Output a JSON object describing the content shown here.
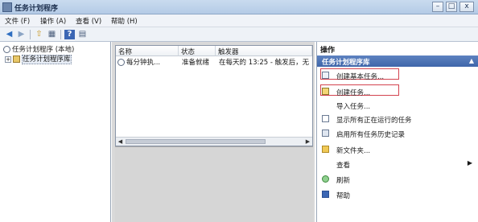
{
  "window": {
    "title": "任务计划程序",
    "minimize_label": "–",
    "maximize_label": "□",
    "close_label": "x"
  },
  "menu": {
    "file": "文件 (F)",
    "action": "操作 (A)",
    "view": "查看 (V)",
    "help": "帮助 (H)"
  },
  "toolbar": {
    "back_glyph": "◀",
    "forward_glyph": "▶",
    "up_glyph": "⇧",
    "show_glyph": "▦",
    "help_glyph": "?",
    "pane_glyph": "▤"
  },
  "tree": {
    "root_label": "任务计划程序 (本地)",
    "expander_glyph": "+",
    "library_label": "任务计划程序库"
  },
  "task_list": {
    "columns": [
      "名称",
      "状态",
      "触发器"
    ],
    "rows": [
      {
        "name": "每分钟执...",
        "status": "准备就绪",
        "trigger": "在每天的 13:25 - 触发后，无"
      }
    ],
    "scroll_left": "◀",
    "scroll_right": "▶"
  },
  "actions": {
    "panel_title": "操作",
    "section_title": "任务计划程序库",
    "collapse_glyph": "▲",
    "submenu_glyph": "▶",
    "items": [
      {
        "label": "创建基本任务...",
        "icon": "calendar-task-icon"
      },
      {
        "label": "创建任务...",
        "icon": "new-task-icon"
      },
      {
        "label": "导入任务...",
        "icon": ""
      },
      {
        "label": "显示所有正在运行的任务",
        "icon": "running-tasks-icon"
      },
      {
        "label": "启用所有任务历史记录",
        "icon": "history-icon"
      },
      {
        "label": "新文件夹...",
        "icon": "folder-icon"
      },
      {
        "label": "查看",
        "icon": ""
      },
      {
        "label": "刷新",
        "icon": "refresh-icon"
      },
      {
        "label": "帮助",
        "icon": "help-icon"
      }
    ]
  },
  "colors": {
    "section_header": "#4a6fb3",
    "highlight_box": "#d3434f"
  }
}
